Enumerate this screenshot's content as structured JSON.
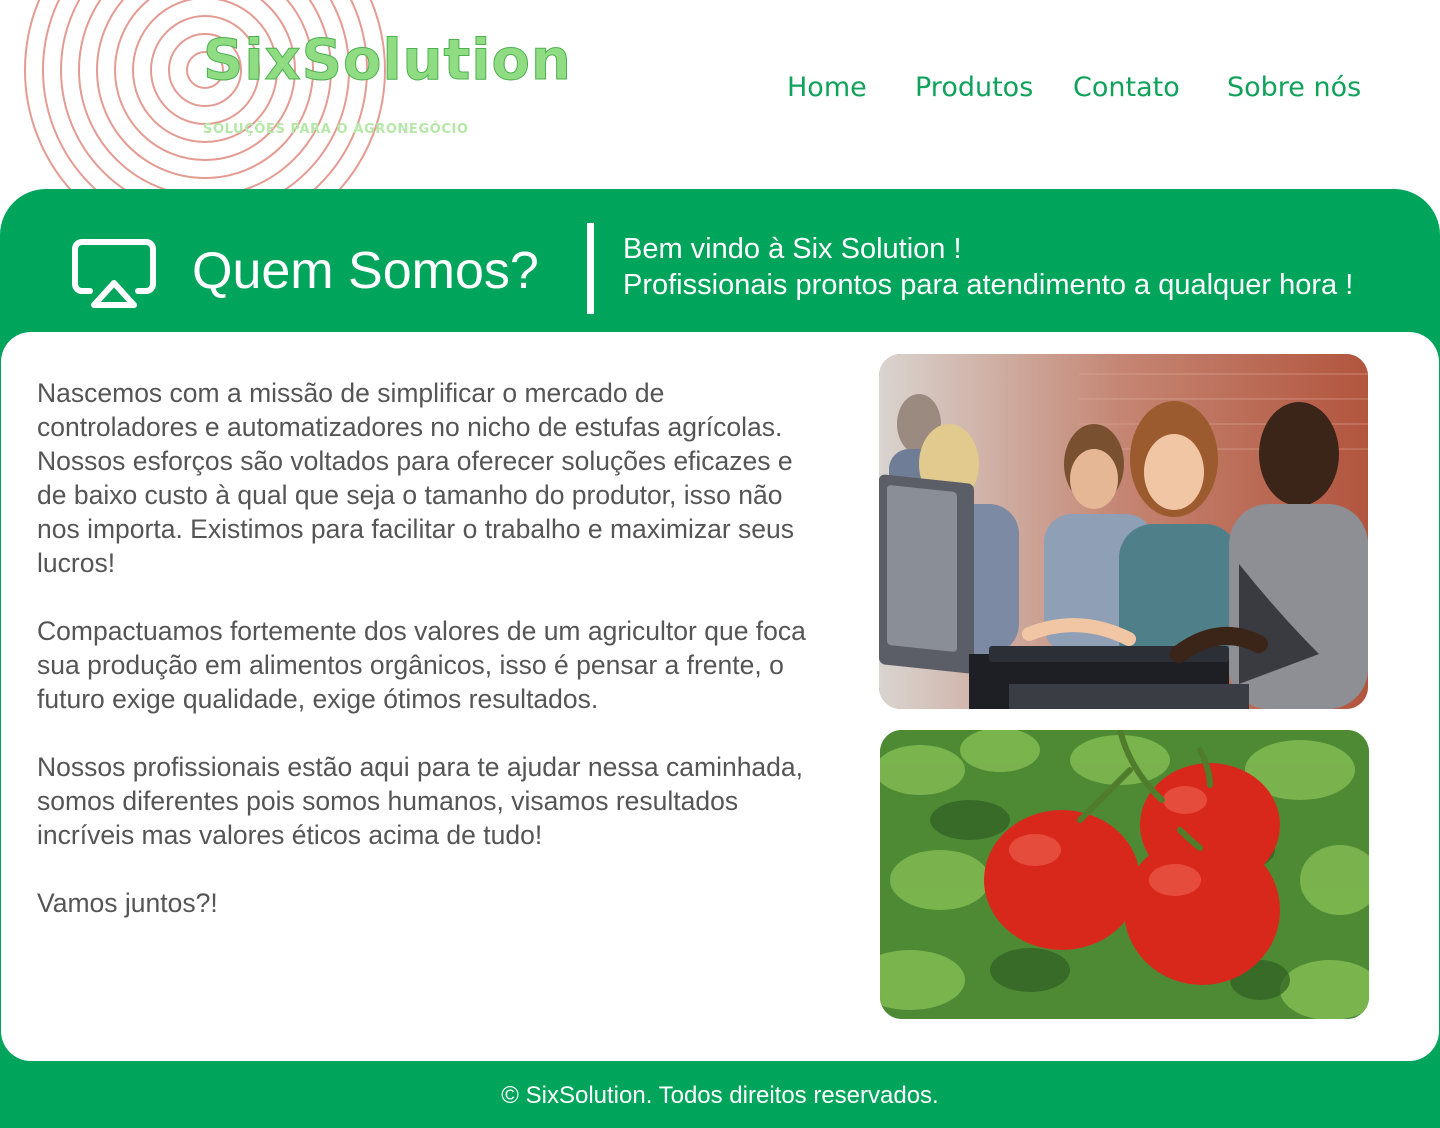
{
  "header": {
    "brand_name": "SixSolution",
    "brand_tagline": "SOLUÇÕES PARA O AGRONEGÓCIO",
    "nav": [
      {
        "label": "Home"
      },
      {
        "label": "Produtos"
      },
      {
        "label": "Contato"
      },
      {
        "label": "Sobre nós"
      }
    ]
  },
  "banner": {
    "icon": "airplay-icon",
    "title": "Quem Somos?",
    "line1": "Bem vindo à Six Solution !",
    "line2": "Profissionais prontos para atendimento a qualquer hora !"
  },
  "main": {
    "paragraphs": [
      "Nascemos com a missão de simplificar o mercado de controladores e automatizadores no nicho de estufas agrícolas. Nossos esforços são voltados para oferecer soluções eficazes e de baixo custo à qual que seja o tamanho do produtor, isso não nos importa. Existimos para facilitar o trabalho e maximizar seus lucros!",
      "Compactuamos fortemente dos valores de um agricultor que foca sua produção em alimentos orgânicos, isso é pensar a frente, o futuro exige qualidade, exige ótimos resultados.",
      "Nossos profissionais estão aqui para te ajudar nessa caminhada, somos diferentes pois somos humanos, visamos resultados incríveis mas valores éticos acima de tudo!",
      "Vamos juntos?!"
    ]
  },
  "footer": {
    "copyright": "© SixSolution. Todos direitos reservados."
  },
  "colors": {
    "primary_green": "#00a55b",
    "nav_text": "#10a25a",
    "body_text": "#555555",
    "brand_green": "#8fdc82",
    "circle_red": "#e08a80"
  }
}
